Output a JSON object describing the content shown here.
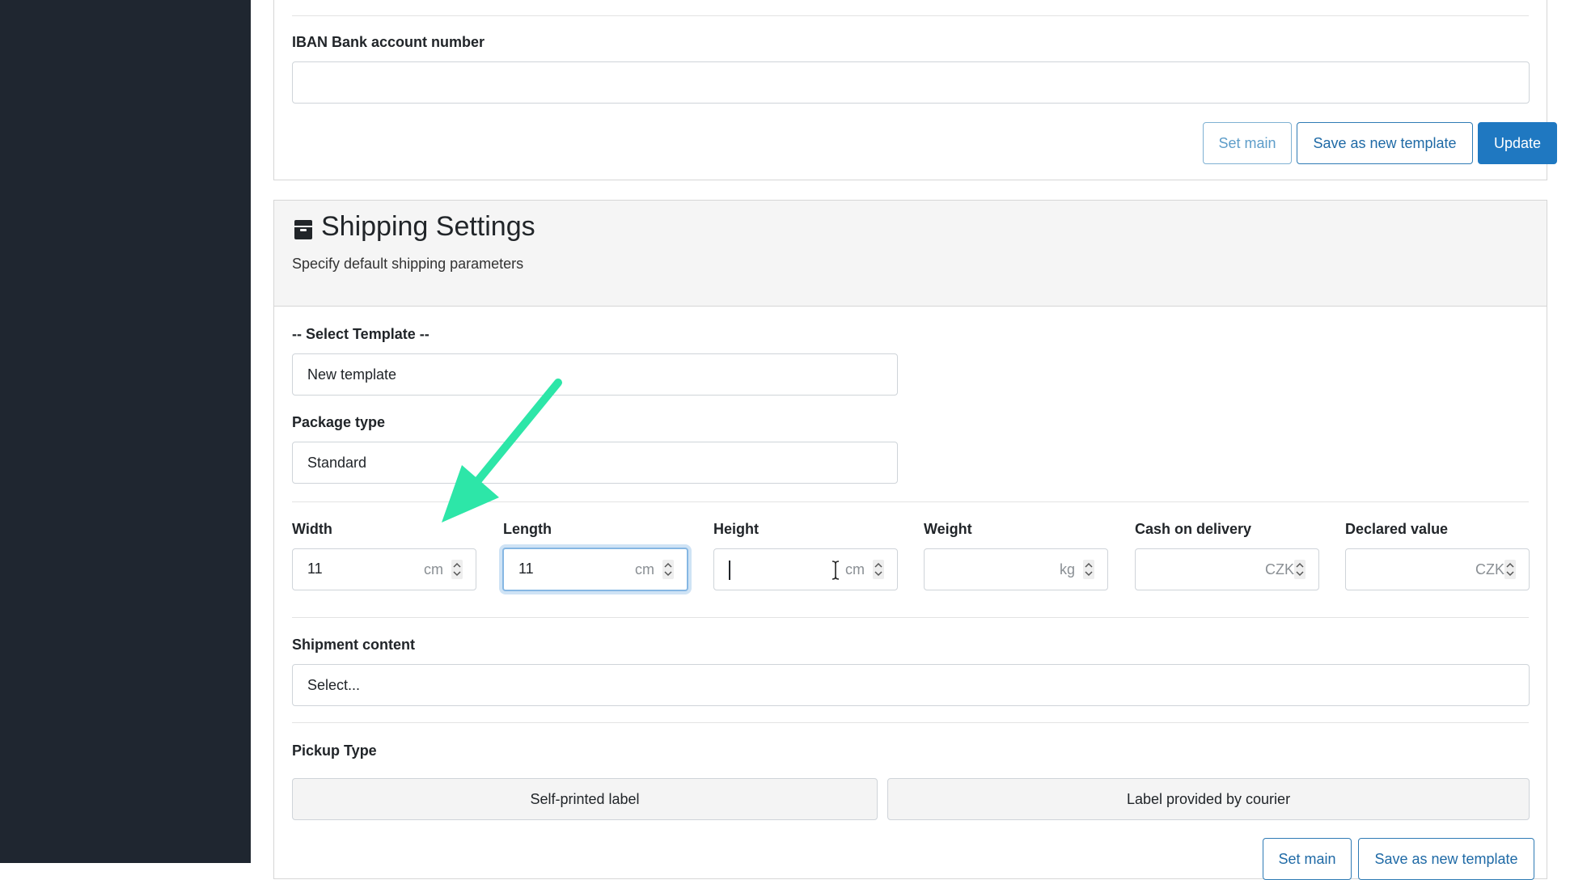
{
  "bank": {
    "iban_label": "IBAN Bank account number",
    "iban_value": "",
    "set_main": "Set main",
    "save_template": "Save as new template",
    "update": "Update"
  },
  "shipping": {
    "title": "Shipping Settings",
    "subtitle": "Specify default shipping parameters",
    "icon": "box-icon",
    "template_label": "-- Select Template --",
    "template_value": "New template",
    "package_label": "Package type",
    "package_value": "Standard",
    "dimensions": [
      {
        "label": "Width",
        "value": "11",
        "unit": "cm"
      },
      {
        "label": "Length",
        "value": "11",
        "unit": "cm"
      },
      {
        "label": "Height",
        "value": "",
        "unit": "cm"
      },
      {
        "label": "Weight",
        "value": "",
        "unit": "kg"
      },
      {
        "label": "Cash on delivery",
        "value": "",
        "unit": "CZK"
      },
      {
        "label": "Declared value",
        "value": "",
        "unit": "CZK"
      }
    ],
    "content_label": "Shipment content",
    "content_value": "Select...",
    "pickup_label": "Pickup Type",
    "pickup_options": [
      "Self-printed label",
      "Label provided by courier"
    ],
    "set_main": "Set main",
    "save_template": "Save as new template"
  },
  "annotation": {
    "arrow_color": "#2de6a8"
  },
  "colors": {
    "sidebar": "#1f2630",
    "primary": "#1f78c1"
  }
}
